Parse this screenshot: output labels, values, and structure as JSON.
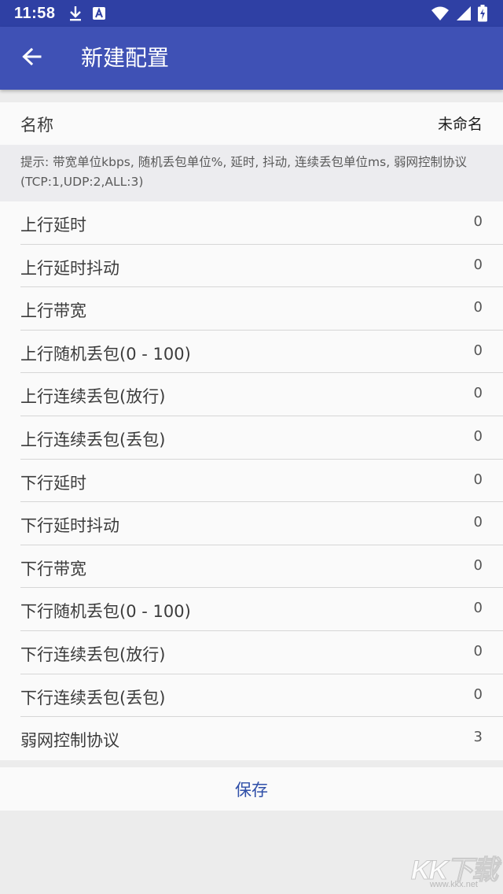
{
  "status_bar": {
    "time": "11:58",
    "icons": [
      "download-icon",
      "a-badge-icon",
      "wifi-icon",
      "signal-icon",
      "battery-icon"
    ]
  },
  "app_bar": {
    "title": "新建配置",
    "back_icon": "arrow-left-icon",
    "color": "#3f51b5"
  },
  "name_field": {
    "label": "名称",
    "value": "未命名"
  },
  "hint": "提示: 带宽单位kbps, 随机丢包单位%, 延时, 抖动, 连续丢包单位ms, 弱网控制协议(TCP:1,UDP:2,ALL:3)",
  "rows": [
    {
      "label": "上行延时",
      "value": "0"
    },
    {
      "label": "上行延时抖动",
      "value": "0"
    },
    {
      "label": "上行带宽",
      "value": "0"
    },
    {
      "label": "上行随机丢包(0 - 100)",
      "value": "0"
    },
    {
      "label": "上行连续丢包(放行)",
      "value": "0"
    },
    {
      "label": "上行连续丢包(丢包)",
      "value": "0"
    },
    {
      "label": "下行延时",
      "value": "0"
    },
    {
      "label": "下行延时抖动",
      "value": "0"
    },
    {
      "label": "下行带宽",
      "value": "0"
    },
    {
      "label": "下行随机丢包(0 - 100)",
      "value": "0"
    },
    {
      "label": "下行连续丢包(放行)",
      "value": "0"
    },
    {
      "label": "下行连续丢包(丢包)",
      "value": "0"
    },
    {
      "label": "弱网控制协议",
      "value": "3"
    }
  ],
  "save_label": "保存",
  "watermark": {
    "text": "KK下载",
    "url": "www.kkx.net"
  },
  "colors": {
    "status_bar": "#2f40a4",
    "accent": "#3f51b5",
    "save_text": "#2f4fa8"
  }
}
